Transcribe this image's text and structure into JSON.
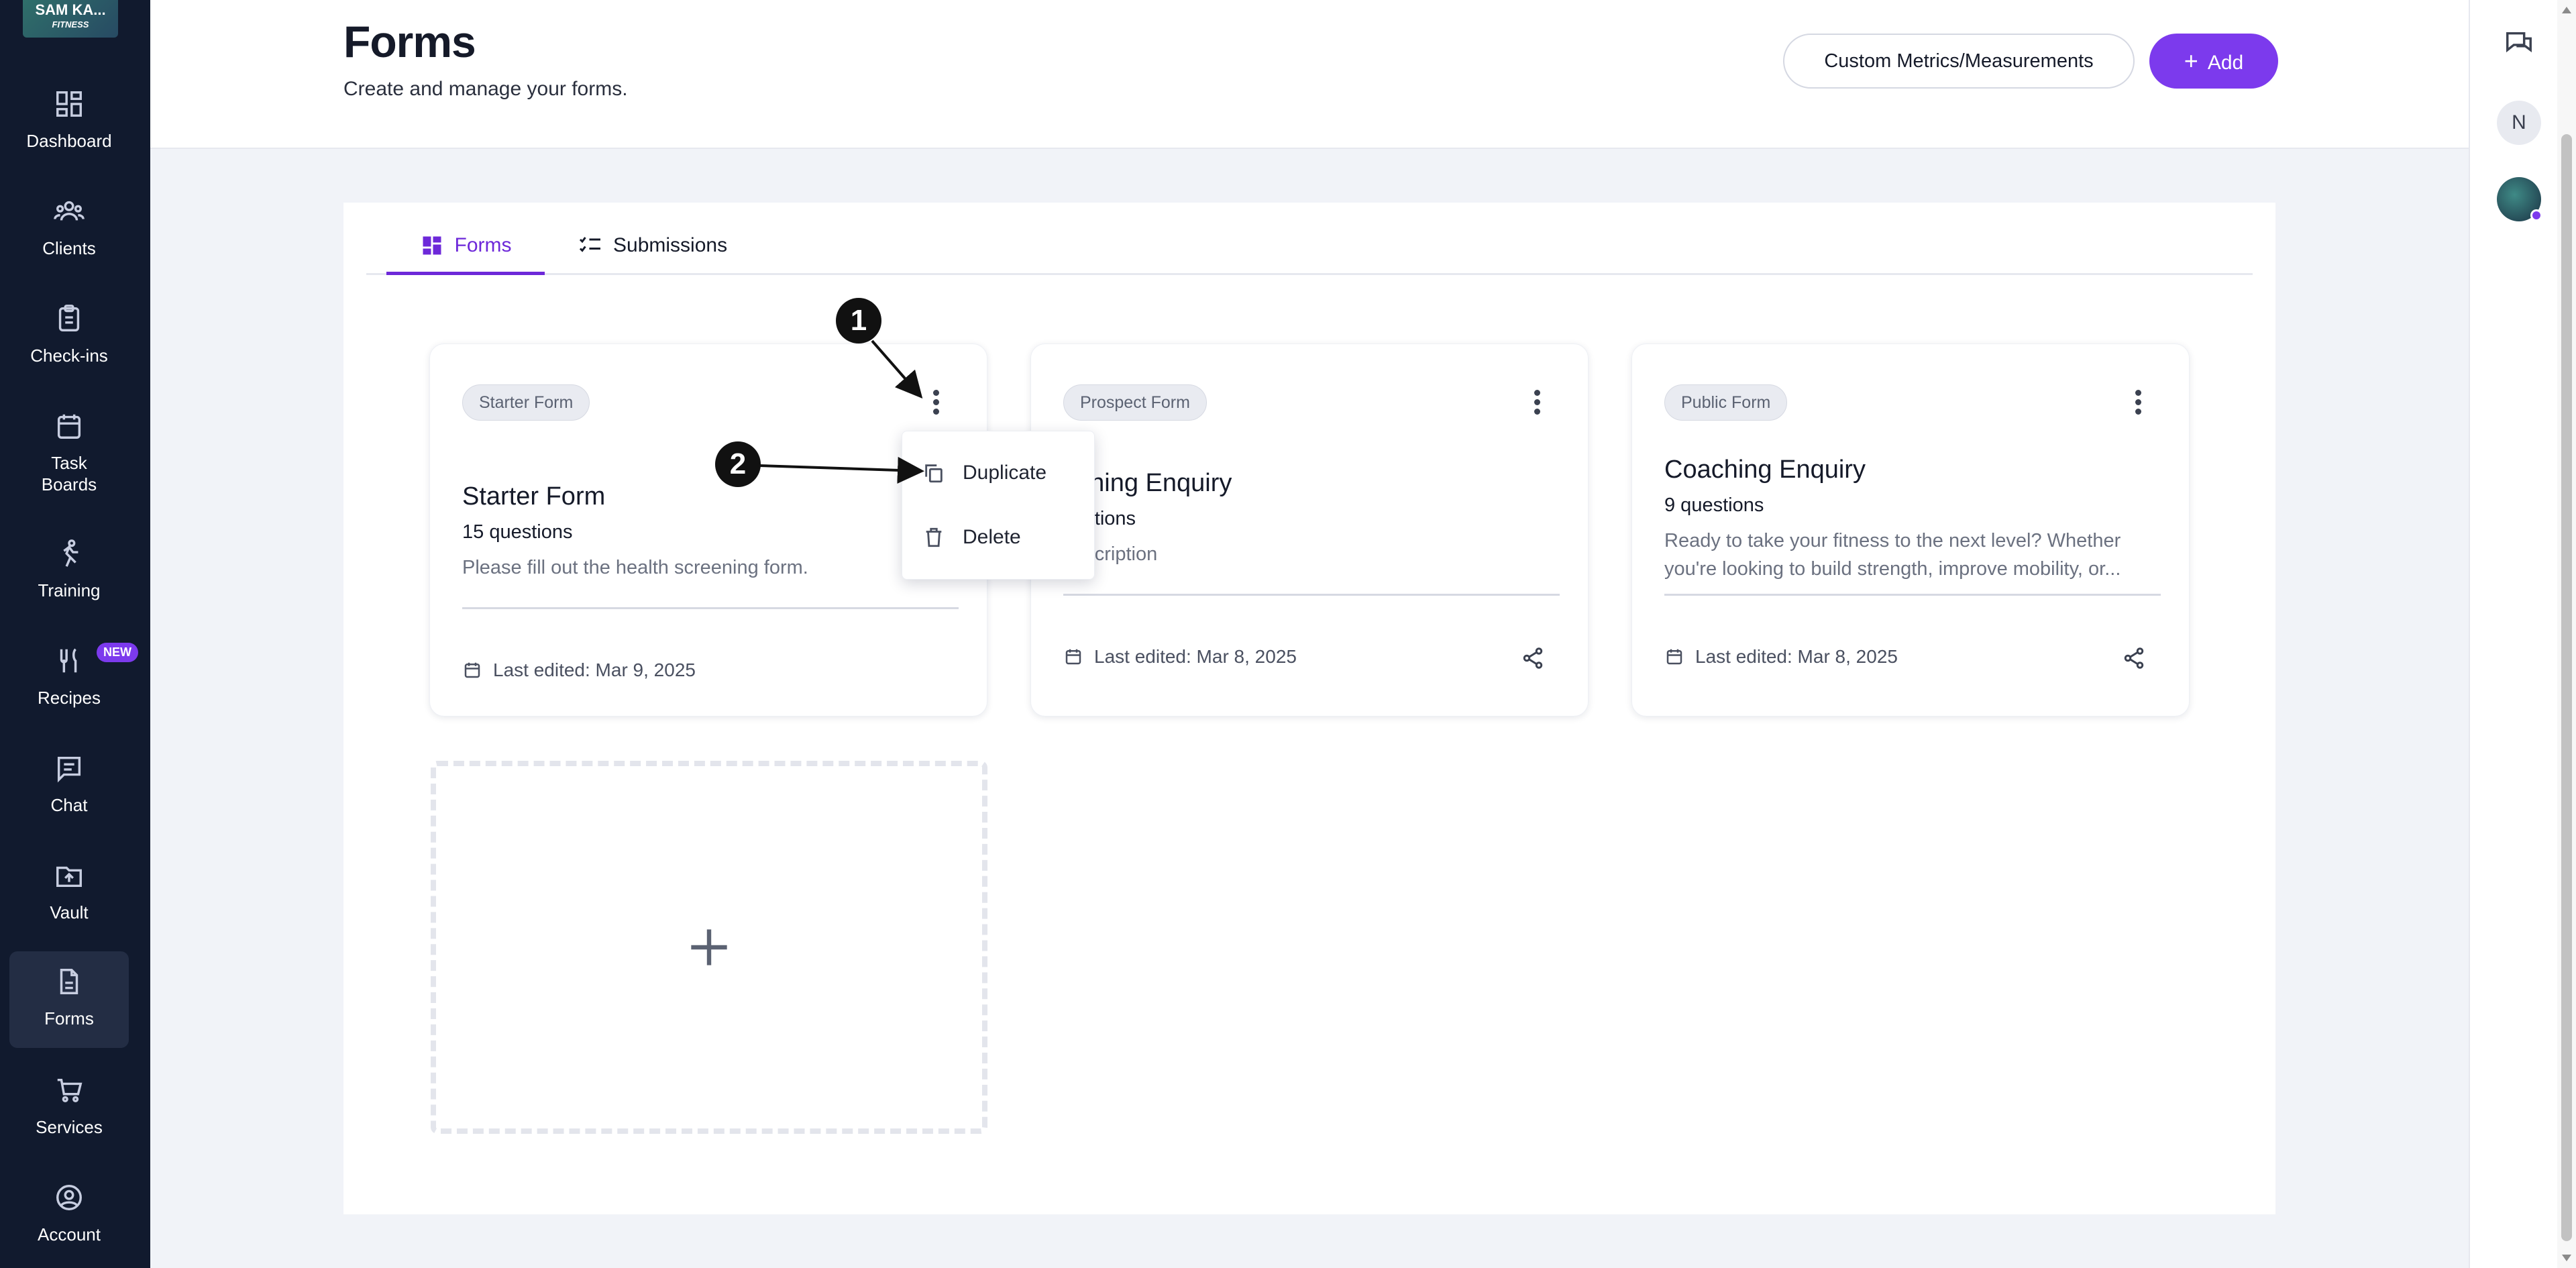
{
  "logo": {
    "line1": "SAM KA...",
    "line2": "FITNESS"
  },
  "sidebar": {
    "items": [
      {
        "label": "Dashboard",
        "icon": "dashboard-icon"
      },
      {
        "label": "Clients",
        "icon": "users-icon"
      },
      {
        "label": "Check-ins",
        "icon": "clipboard-icon"
      },
      {
        "label": "Task Boards",
        "icon": "calendar-icon"
      },
      {
        "label": "Training",
        "icon": "running-icon"
      },
      {
        "label": "Recipes",
        "icon": "utensils-icon",
        "badge": "NEW"
      },
      {
        "label": "Chat",
        "icon": "message-icon"
      },
      {
        "label": "Vault",
        "icon": "folder-upload-icon"
      },
      {
        "label": "Forms",
        "icon": "document-icon",
        "active": true
      },
      {
        "label": "Services",
        "icon": "cart-icon"
      },
      {
        "label": "Account",
        "icon": "account-circle-icon"
      }
    ]
  },
  "header": {
    "title": "Forms",
    "subtitle": "Create and manage your forms.",
    "metrics_button": "Custom Metrics/Measurements",
    "add_button": "Add"
  },
  "tabs": [
    {
      "label": "Forms",
      "active": true
    },
    {
      "label": "Submissions",
      "active": false
    }
  ],
  "cards": [
    {
      "badge": "Starter Form",
      "title": "Starter Form",
      "questions": "15 questions",
      "description": "Please fill out the health screening form.",
      "last_edited": "Last edited: Mar 9, 2025"
    },
    {
      "badge": "Prospect Form",
      "title": "aching Enquiry",
      "questions": "uestions",
      "description": "description",
      "last_edited": "Last edited: Mar 8, 2025"
    },
    {
      "badge": "Public Form",
      "title": "Coaching Enquiry",
      "questions": "9 questions",
      "description": "Ready to take your fitness to the next level? Whether you're looking to build strength, improve mobility, or...",
      "last_edited": "Last edited: Mar 8, 2025"
    }
  ],
  "menu": {
    "duplicate": "Duplicate",
    "delete": "Delete"
  },
  "annotations": {
    "one": "1",
    "two": "2"
  },
  "rail": {
    "avatar_initial": "N"
  },
  "colors": {
    "accent": "#7c3aed",
    "sidebar_bg": "#111a2e",
    "page_bg": "#f1f3f8"
  }
}
